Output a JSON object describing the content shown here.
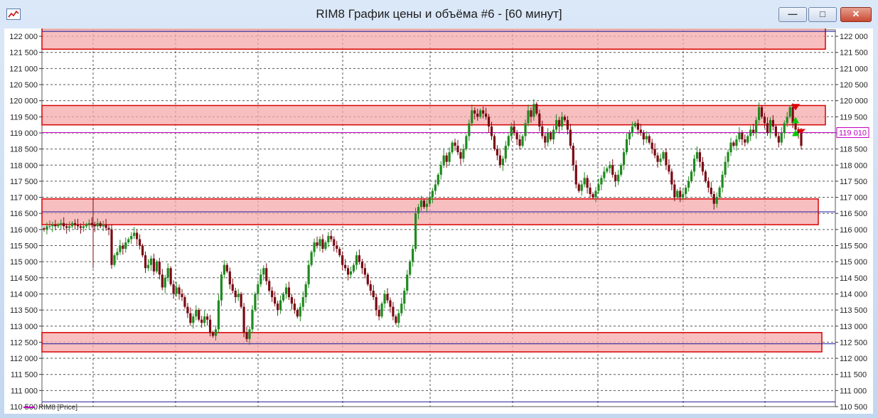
{
  "window": {
    "title": "RIM8 График цены и объёма #6 - [60 минут]",
    "buttons": {
      "minimize": "—",
      "maximize": "□",
      "close": "✕"
    }
  },
  "legend": {
    "label": "RIM8 [Price]"
  },
  "price_label": "119 010",
  "chart_data": {
    "type": "candlestick",
    "ylim": [
      110500,
      122200
    ],
    "y_ticks": [
      "122 000",
      "121 500",
      "121 000",
      "120 500",
      "120 000",
      "119 500",
      "119 000",
      "118 500",
      "118 000",
      "117 500",
      "117 000",
      "116 500",
      "116 000",
      "115 500",
      "115 000",
      "114 500",
      "114 000",
      "113 500",
      "113 000",
      "112 500",
      "112 000",
      "111 500",
      "111 000",
      "110 500"
    ],
    "current_price": 119010,
    "zones": [
      {
        "from": 121600,
        "to": 122350
      },
      {
        "from": 119250,
        "to": 119850
      },
      {
        "from": 116150,
        "to": 116950
      },
      {
        "from": 112200,
        "to": 112800
      }
    ],
    "levels": [
      122150,
      116550,
      112450,
      110650
    ],
    "series": [
      {
        "values": [
          116000,
          116100,
          116100,
          116150,
          116100,
          116150,
          116200,
          116100,
          116050,
          116100,
          116200,
          116150,
          116100,
          116050,
          116100,
          116150,
          116200,
          116150,
          116100,
          116200,
          116100,
          116150,
          116050,
          116000,
          114900,
          115200,
          115300,
          115500,
          115400,
          115600,
          115700,
          115800,
          115900,
          115700,
          115500,
          115200,
          114800,
          114900,
          115100,
          114700,
          115000,
          114600,
          114200,
          114500,
          114800,
          114300,
          114000,
          114200,
          114000,
          113900,
          113600,
          113400,
          113100,
          113300,
          113500,
          113200,
          113100,
          113300,
          113200,
          112800,
          112700,
          112900,
          113800,
          114600,
          114900,
          114700,
          114300,
          114100,
          113900,
          114000,
          113600,
          112800,
          112600,
          112900,
          113500,
          114000,
          114300,
          114600,
          114800,
          114400,
          114100,
          113900,
          113700,
          113500,
          113800,
          114000,
          114200,
          113900,
          113700,
          113500,
          113300,
          113600,
          113900,
          114300,
          114900,
          115300,
          115600,
          115500,
          115700,
          115400,
          115600,
          115800,
          115700,
          115500,
          115400,
          115200,
          114900,
          114800,
          114600,
          114700,
          114900,
          115200,
          115000,
          114800,
          114600,
          114300,
          114100,
          113900,
          113500,
          113300,
          113700,
          114000,
          113800,
          113600,
          113300,
          113100,
          113400,
          113700,
          114100,
          114600,
          115000,
          115400,
          116500,
          116700,
          116900,
          116700,
          116800,
          117000,
          117200,
          117400,
          117700,
          118000,
          118300,
          118100,
          118400,
          118700,
          118600,
          118400,
          118200,
          118500,
          118900,
          119300,
          119700,
          119600,
          119500,
          119700,
          119600,
          119500,
          119200,
          118900,
          118500,
          118300,
          118000,
          118200,
          118600,
          118900,
          119200,
          119000,
          118800,
          118600,
          118900,
          119300,
          119700,
          119500,
          119900,
          119600,
          119200,
          118900,
          118700,
          119000,
          118800,
          119100,
          119400,
          119200,
          119500,
          119400,
          119100,
          118600,
          118000,
          117400,
          117200,
          117400,
          117600,
          117300,
          117100,
          117000,
          117200,
          117400,
          117600,
          117800,
          117900,
          118000,
          117700,
          117500,
          117700,
          118000,
          118400,
          118800,
          119000,
          119200,
          119300,
          119100,
          119000,
          118800,
          118900,
          118700,
          118500,
          118300,
          118100,
          118200,
          118400,
          118000,
          117800,
          117400,
          117000,
          117200,
          117000,
          117100,
          117300,
          117500,
          117800,
          118200,
          118400,
          118100,
          117800,
          117500,
          117300,
          117100,
          116800,
          117000,
          117300,
          117700,
          118100,
          118400,
          118700,
          118600,
          118800,
          119000,
          118800,
          118700,
          118900,
          119100,
          119000,
          119400,
          119800,
          119500,
          119300,
          119000,
          119400,
          119200,
          118900,
          118700,
          119000,
          119300,
          119500,
          119800,
          119300,
          119100,
          119000,
          118600
        ]
      }
    ]
  }
}
